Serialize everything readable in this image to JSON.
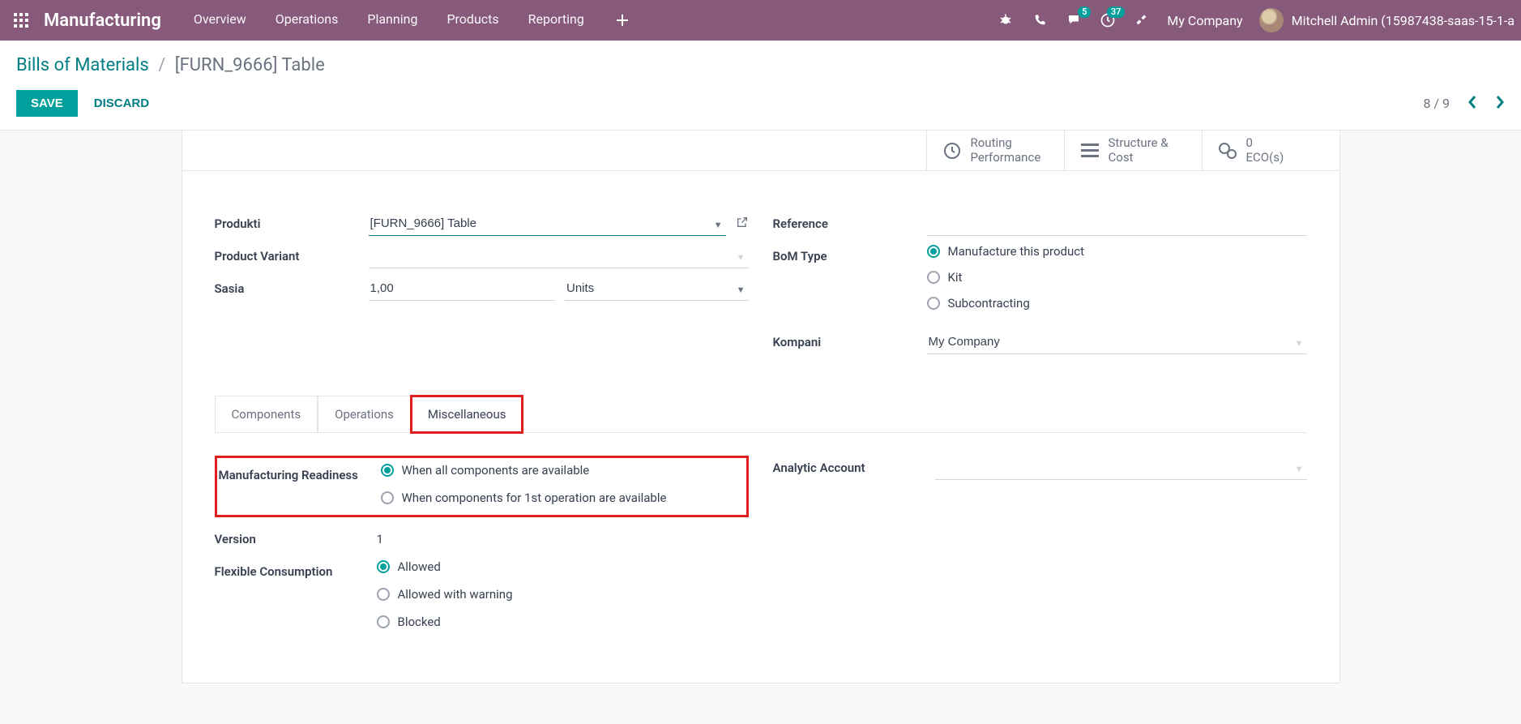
{
  "navbar": {
    "brand": "Manufacturing",
    "menu": [
      "Overview",
      "Operations",
      "Planning",
      "Products",
      "Reporting"
    ],
    "plus_icon": "plus-icon",
    "right_icons": {
      "bug": "bug-icon",
      "phone": "phone-icon",
      "chat": "chat-icon",
      "chat_badge": "5",
      "clock": "clock-icon",
      "clock_badge": "37",
      "tools": "tools-icon"
    },
    "company": "My Company",
    "user": "Mitchell Admin (15987438-saas-15-1-a"
  },
  "breadcrumb": {
    "parent": "Bills of Materials",
    "sep": "/",
    "current": "[FURN_9666] Table"
  },
  "buttons": {
    "save": "SAVE",
    "discard": "DISCARD"
  },
  "pager": {
    "text": "8 / 9"
  },
  "stats": {
    "routing": {
      "l1": "Routing",
      "l2": "Performance"
    },
    "structure": {
      "l1": "Structure &",
      "l2": "Cost"
    },
    "eco": {
      "l1": "0",
      "l2": "ECO(s)"
    }
  },
  "form": {
    "left": {
      "produkti": {
        "label": "Produkti",
        "value": "[FURN_9666] Table"
      },
      "variant": {
        "label": "Product Variant",
        "value": ""
      },
      "sasia": {
        "label": "Sasia",
        "qty": "1,00",
        "uom": "Units"
      }
    },
    "right": {
      "reference": {
        "label": "Reference",
        "value": ""
      },
      "bomtype": {
        "label": "BoM Type",
        "options": [
          "Manufacture this product",
          "Kit",
          "Subcontracting"
        ],
        "selected": 0
      },
      "kompani": {
        "label": "Kompani",
        "value": "My Company"
      }
    }
  },
  "tabs": [
    "Components",
    "Operations",
    "Miscellaneous"
  ],
  "active_tab": 2,
  "misc": {
    "left": {
      "readiness": {
        "label": "Manufacturing Readiness",
        "options": [
          "When all components are available",
          "When components for 1st operation are available"
        ],
        "selected": 0
      },
      "version": {
        "label": "Version",
        "value": "1"
      },
      "flex": {
        "label": "Flexible Consumption",
        "options": [
          "Allowed",
          "Allowed with warning",
          "Blocked"
        ],
        "selected": 0
      }
    },
    "right": {
      "analytic": {
        "label": "Analytic Account",
        "value": ""
      }
    }
  }
}
